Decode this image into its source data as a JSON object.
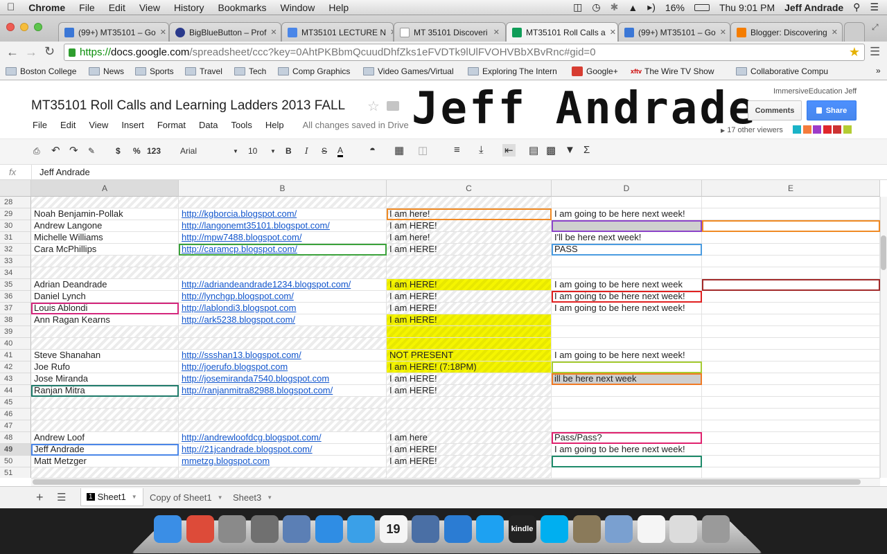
{
  "menubar": {
    "apple": "",
    "app": "Chrome",
    "items": [
      "File",
      "Edit",
      "View",
      "History",
      "Bookmarks",
      "Window",
      "Help"
    ],
    "battery": "16%",
    "clock": "Thu 9:01 PM",
    "user": "Jeff Andrade"
  },
  "tabs": [
    {
      "label": "(99+) MT35101 – Go",
      "color": "#3b77d6"
    },
    {
      "label": "BigBlueButton – Prof",
      "color": "#2a3a8c"
    },
    {
      "label": "MT35101 LECTURE N",
      "color": "#4a86e8"
    },
    {
      "label": "MT 35101 Discoveri",
      "color": "#ffffff"
    },
    {
      "label": "MT35101 Roll Calls a",
      "color": "#0f9d58"
    },
    {
      "label": "(99+) MT35101 – Go",
      "color": "#3b77d6"
    },
    {
      "label": "Blogger: Discovering",
      "color": "#f57d00"
    }
  ],
  "address": {
    "scheme": "https://",
    "host": "docs.google.com",
    "path": "/spreadsheet/ccc?key=0AhtPKBbmQcuudDhfZks1eFVDTk9lUlFVOHVBbXBvRnc#gid=0"
  },
  "bookmarks": [
    "Boston College",
    "News",
    "Sports",
    "Travel",
    "Tech",
    "Comp Graphics",
    "Video Games/Virtual",
    "Exploring The Intern",
    "Google+",
    "The Wire TV Show",
    "Collaborative Compu"
  ],
  "doc": {
    "title": "MT35101 Roll Calls and Learning Ladders 2013 FALL",
    "menu": [
      "File",
      "Edit",
      "View",
      "Insert",
      "Format",
      "Data",
      "Tools",
      "Help"
    ],
    "saved": "All changes saved in Drive",
    "signature": "Jeff Andrade",
    "user": "ImmersiveEducation Jeff",
    "comments": "Comments",
    "share": "Share",
    "viewers": "17 other viewers",
    "viewer_colors": [
      "#1ab3c7",
      "#f47c3c",
      "#9d3bc9",
      "#e0262b",
      "#cc3333",
      "#b3cc33"
    ]
  },
  "toolbar": {
    "font": "Arial",
    "size": "10",
    "currency": "$",
    "percent": "%",
    "format": "123"
  },
  "formula": {
    "fx": "fx",
    "value": "Jeff Andrade"
  },
  "columns": [
    "A",
    "B",
    "C",
    "D",
    "E"
  ],
  "rows": [
    {
      "n": "28",
      "a": "",
      "b": "",
      "c": "",
      "d": "",
      "e": ""
    },
    {
      "n": "29",
      "a": "Noah Benjamin-Pollak",
      "b": "http://kgborcia.blogspot.com/",
      "c": "I am here!",
      "d": "I am going to be here next week!",
      "e": ""
    },
    {
      "n": "30",
      "a": "Andrew Langone",
      "b": "http://langonemt35101.blogspot.com/",
      "c": "I am HERE!",
      "d": "",
      "e": ""
    },
    {
      "n": "31",
      "a": "Michelle Williams",
      "b": "http://mpw7488.blogspot.com/",
      "c": "I am here!",
      "d": "I'll be here next week!",
      "e": ""
    },
    {
      "n": "32",
      "a": "Cara McPhillips",
      "b": "http://caramcp.blogspot.com/",
      "c": "I am HERE!",
      "d": "PASS",
      "e": ""
    },
    {
      "n": "33",
      "a": "",
      "b": "",
      "c": "",
      "d": "",
      "e": ""
    },
    {
      "n": "34",
      "a": "",
      "b": "",
      "c": "",
      "d": "",
      "e": ""
    },
    {
      "n": "35",
      "a": "Adrian Deandrade",
      "b": "http://adriandeandrade1234.blogspot.com/",
      "c": "I am HERE!",
      "d": "I am going to be here next week",
      "e": ""
    },
    {
      "n": "36",
      "a": "Daniel Lynch",
      "b": "http://lynchgp.blogspot.com/",
      "c": "I am HERE!",
      "d": "I am going to be here next week!",
      "e": ""
    },
    {
      "n": "37",
      "a": "Louis Ablondi",
      "b": "http://lablondi3.blogspot.com",
      "c": "I am HERE!",
      "d": "I am going to be here next week!",
      "e": ""
    },
    {
      "n": "38",
      "a": "Ann Ragan Kearns",
      "b": "http://ark5238.blogspot.com/",
      "c": "I am HERE!",
      "d": "",
      "e": ""
    },
    {
      "n": "39",
      "a": "",
      "b": "",
      "c": "",
      "d": "",
      "e": ""
    },
    {
      "n": "40",
      "a": "",
      "b": "",
      "c": "",
      "d": "",
      "e": ""
    },
    {
      "n": "41",
      "a": "Steve Shanahan",
      "b": "http://ssshan13.blogspot.com/",
      "c": "NOT PRESENT",
      "d": "I am going to be here next week!",
      "e": ""
    },
    {
      "n": "42",
      "a": "Joe Rufo",
      "b": "http://joerufo.blogspot.com",
      "c": "I am HERE! (7:18PM)",
      "d": "",
      "e": ""
    },
    {
      "n": "43",
      "a": "Jose Miranda",
      "b": "http://josemiranda7540.blogspot.com",
      "c": "I am HERE!",
      "d": "ill be here next week",
      "e": ""
    },
    {
      "n": "44",
      "a": "Ranjan Mitra",
      "b": "http://ranjanmitra82988.blogspot.com/",
      "c": "I am HERE!",
      "d": "",
      "e": ""
    },
    {
      "n": "45",
      "a": "",
      "b": "",
      "c": "",
      "d": "",
      "e": ""
    },
    {
      "n": "46",
      "a": "",
      "b": "",
      "c": "",
      "d": "",
      "e": ""
    },
    {
      "n": "47",
      "a": "",
      "b": "",
      "c": "",
      "d": "",
      "e": ""
    },
    {
      "n": "48",
      "a": "Andrew Loof",
      "b": "http://andrewloofdcg.blogspot.com/",
      "c": "I am here",
      "d": "Pass/Pass?",
      "e": ""
    },
    {
      "n": "49",
      "a": "Jeff Andrade",
      "b": "http://21jcandrade.blogspot.com/",
      "c": "I am HERE!",
      "d": "I am going to be here next week!",
      "e": ""
    },
    {
      "n": "50",
      "a": "Matt Metzger",
      "b": "mmetzg.blogspot.com",
      "c": "I am HERE!",
      "d": "",
      "e": ""
    },
    {
      "n": "51",
      "a": "",
      "b": "",
      "c": "",
      "d": "",
      "e": ""
    }
  ],
  "sheets": [
    "Sheet1",
    "Copy of Sheet1",
    "Sheet3"
  ],
  "dock": [
    "finder",
    "chrome",
    "system-preferences",
    "launchpad",
    "preview",
    "app-store",
    "itunes",
    "calendar",
    "iphoto",
    "word",
    "twitter",
    "kindle",
    "skype",
    "gimp",
    "folder",
    "document",
    "web-image",
    "trash"
  ],
  "dock_calendar_day": "19",
  "dock_kindle_label": "kindle"
}
